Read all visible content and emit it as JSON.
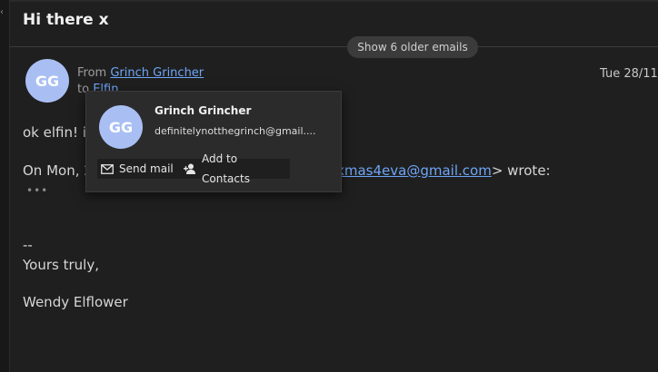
{
  "email": {
    "subject": "Hi there x",
    "older_emails_label": "Show 6 older emails",
    "sender_initials": "GG",
    "from_label": "From",
    "from_name": "Grinch Grincher",
    "to_label": "to",
    "to_name": "Elfin",
    "date": "Tue 28/11/",
    "body": {
      "line1": "ok elfin! i",
      "line2_start": "On Mon, 2",
      "line2_email": "xmas4eva@gmail.com",
      "line2_end": "> wrote:",
      "show_trimmed": "•••",
      "signature_dash": "--",
      "signature_closing": "Yours truly,",
      "signature_name": "Wendy Elflower"
    }
  },
  "contact_popup": {
    "initials": "GG",
    "name": "Grinch Grincher",
    "email": "definitelynotthegrinch@gmail....",
    "send_mail_label": "Send mail",
    "add_contact_label": "Add to Contacts",
    "icons": {
      "send": "envelope-icon",
      "add": "add-person-icon"
    }
  },
  "colors": {
    "background": "#1f1f1f",
    "avatar": "#a9bff3",
    "link": "#6ea5f6",
    "popup": "#2b2b2b"
  }
}
